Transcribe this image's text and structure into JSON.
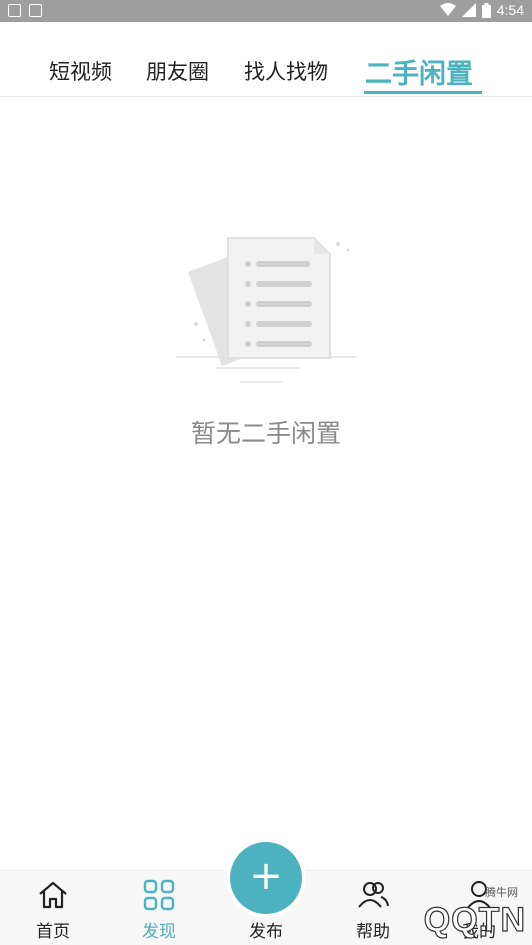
{
  "status_bar": {
    "time": "4:54"
  },
  "tabs": [
    {
      "label": "短视频"
    },
    {
      "label": "朋友圈"
    },
    {
      "label": "找人找物"
    },
    {
      "label": "二手闲置",
      "active": true
    }
  ],
  "empty_state": {
    "message": "暂无二手闲置"
  },
  "bottom_nav": {
    "items": [
      {
        "label": "首页",
        "icon": "home-icon"
      },
      {
        "label": "发现",
        "icon": "grid-icon",
        "active": true
      },
      {
        "label": "发布",
        "icon": "plus-icon"
      },
      {
        "label": "帮助",
        "icon": "people-icon"
      },
      {
        "label": "我的",
        "icon": "user-icon"
      }
    ]
  },
  "watermark": {
    "site": "腾牛网",
    "logo": "QQTN"
  },
  "colors": {
    "accent": "#4db2bf",
    "status_bar": "#9e9e9e",
    "text_muted": "#8a8a8a"
  }
}
